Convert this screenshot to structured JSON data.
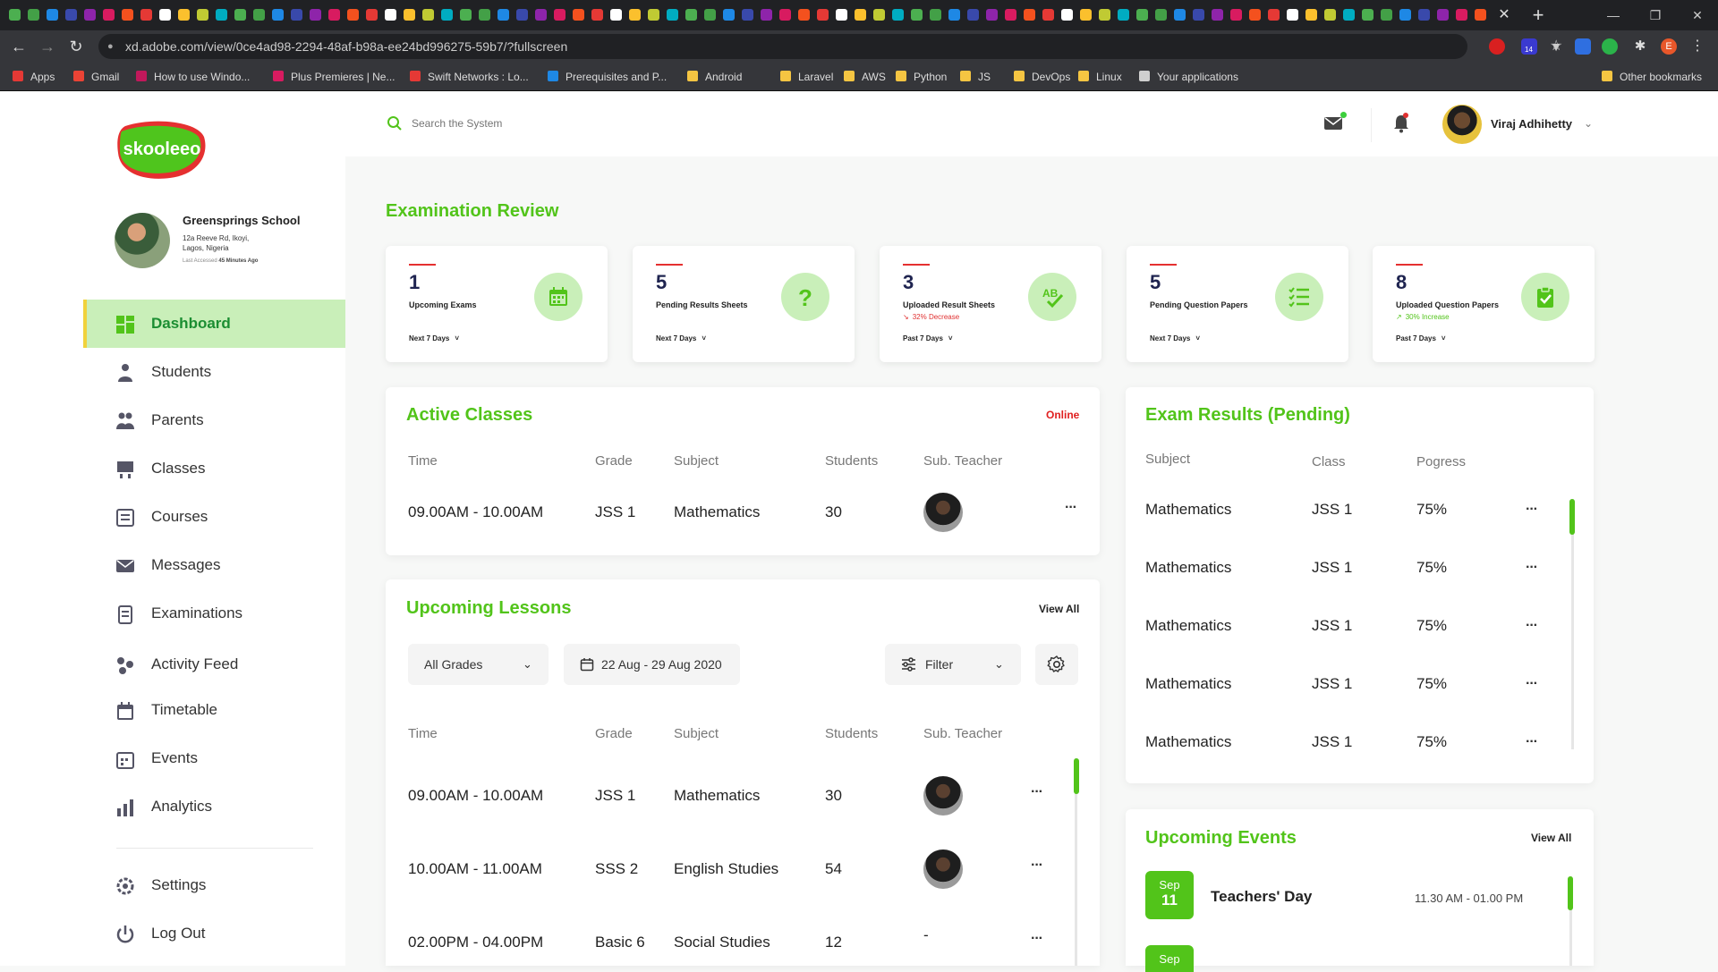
{
  "browser": {
    "url": "xd.adobe.com/view/0ce4ad98-2294-48af-b98a-ee24bd996275-59b7/?fullscreen",
    "tab_close": "✕",
    "new_tab": "+",
    "bookmarks": [
      "Apps",
      "Gmail",
      "How to use Windo...",
      "Plus Premieres | Ne...",
      "Swift Networks : Lo...",
      "Prerequisites and P...",
      "Android",
      "Laravel",
      "AWS",
      "Python",
      "JS",
      "DevOps",
      "Linux",
      "Your applications"
    ],
    "other_bookmarks": "Other bookmarks",
    "profile_initial": "E",
    "ext_badge": "14"
  },
  "app": {
    "logo_text": "skooleeo",
    "school": {
      "name": "Greensprings School",
      "address": "12a Reeve Rd, Ikoyi,\nLagos, Nigeria",
      "access_prefix": "Last Accessed ",
      "access_time": "45 Minutes Ago"
    },
    "nav": [
      {
        "label": "Dashboard",
        "icon": "dashboard-icon"
      },
      {
        "label": "Students",
        "icon": "students-icon"
      },
      {
        "label": "Parents",
        "icon": "parents-icon"
      },
      {
        "label": "Classes",
        "icon": "classes-icon"
      },
      {
        "label": "Courses",
        "icon": "courses-icon"
      },
      {
        "label": "Messages",
        "icon": "messages-icon"
      },
      {
        "label": "Examinations",
        "icon": "examinations-icon"
      },
      {
        "label": "Activity Feed",
        "icon": "activity-feed-icon"
      },
      {
        "label": "Timetable",
        "icon": "timetable-icon"
      },
      {
        "label": "Events",
        "icon": "events-icon"
      },
      {
        "label": "Analytics",
        "icon": "analytics-icon"
      },
      {
        "label": "Settings",
        "icon": "settings-icon"
      },
      {
        "label": "Log Out",
        "icon": "logout-icon"
      }
    ],
    "topbar": {
      "search_placeholder": "Search the System",
      "user_name": "Viraj Adhihetty"
    },
    "exam_review": {
      "title": "Examination Review",
      "cards": [
        {
          "value": "1",
          "label": "Upcoming Exams",
          "change": "",
          "period": "Next 7 Days",
          "icon": "calendar-icon"
        },
        {
          "value": "5",
          "label": "Pending Results Sheets",
          "change": "",
          "period": "Next 7 Days",
          "icon": "question-icon"
        },
        {
          "value": "3",
          "label": "Uploaded Result Sheets",
          "change": "32% Decrease",
          "period": "Past 7 Days",
          "icon": "ab-check-icon"
        },
        {
          "value": "5",
          "label": "Pending Question Papers",
          "change": "",
          "period": "Next 7 Days",
          "icon": "checklist-icon"
        },
        {
          "value": "8",
          "label": "Uploaded Question Papers",
          "change": "30% Increase",
          "period": "Past 7 Days",
          "icon": "clipboard-check-icon"
        }
      ]
    },
    "active_classes": {
      "title": "Active Classes",
      "status": "Online",
      "headers": [
        "Time",
        "Grade",
        "Subject",
        "Students",
        "Sub. Teacher"
      ],
      "rows": [
        {
          "time": "09.00AM - 10.00AM",
          "grade": "JSS 1",
          "subject": "Mathematics",
          "students": "30"
        }
      ]
    },
    "upcoming_lessons": {
      "title": "Upcoming Lessons",
      "view_all": "View All",
      "grade_filter": "All Grades",
      "date_range": "22 Aug - 29 Aug 2020",
      "filter_label": "Filter",
      "headers": [
        "Time",
        "Grade",
        "Subject",
        "Students",
        "Sub. Teacher"
      ],
      "rows": [
        {
          "time": "09.00AM - 10.00AM",
          "grade": "JSS 1",
          "subject": "Mathematics",
          "students": "30",
          "teacher": ""
        },
        {
          "time": "10.00AM - 11.00AM",
          "grade": "SSS 2",
          "subject": "English Studies",
          "students": "54",
          "teacher": ""
        },
        {
          "time": "02.00PM - 04.00PM",
          "grade": "Basic 6",
          "subject": "Social Studies",
          "students": "12",
          "teacher": "-"
        }
      ]
    },
    "exam_results": {
      "title": "Exam Results (Pending)",
      "headers": [
        "Subject",
        "Class",
        "Pogress"
      ],
      "rows": [
        {
          "subject": "Mathematics",
          "class": "JSS 1",
          "progress": "75%"
        },
        {
          "subject": "Mathematics",
          "class": "JSS 1",
          "progress": "75%"
        },
        {
          "subject": "Mathematics",
          "class": "JSS 1",
          "progress": "75%"
        },
        {
          "subject": "Mathematics",
          "class": "JSS 1",
          "progress": "75%"
        },
        {
          "subject": "Mathematics",
          "class": "JSS 1",
          "progress": "75%"
        }
      ]
    },
    "upcoming_events": {
      "title": "Upcoming Events",
      "view_all": "View All",
      "events": [
        {
          "month": "Sep",
          "day": "11",
          "name": "Teachers' Day",
          "time": "11.30 AM - 01.00 PM"
        },
        {
          "month": "Sep",
          "day": "",
          "name": "",
          "time": ""
        }
      ]
    },
    "colors": {
      "accent": "#52c41a",
      "active_bg": "#c9efb9",
      "alert": "#e03030",
      "navy": "#1f2450"
    }
  }
}
